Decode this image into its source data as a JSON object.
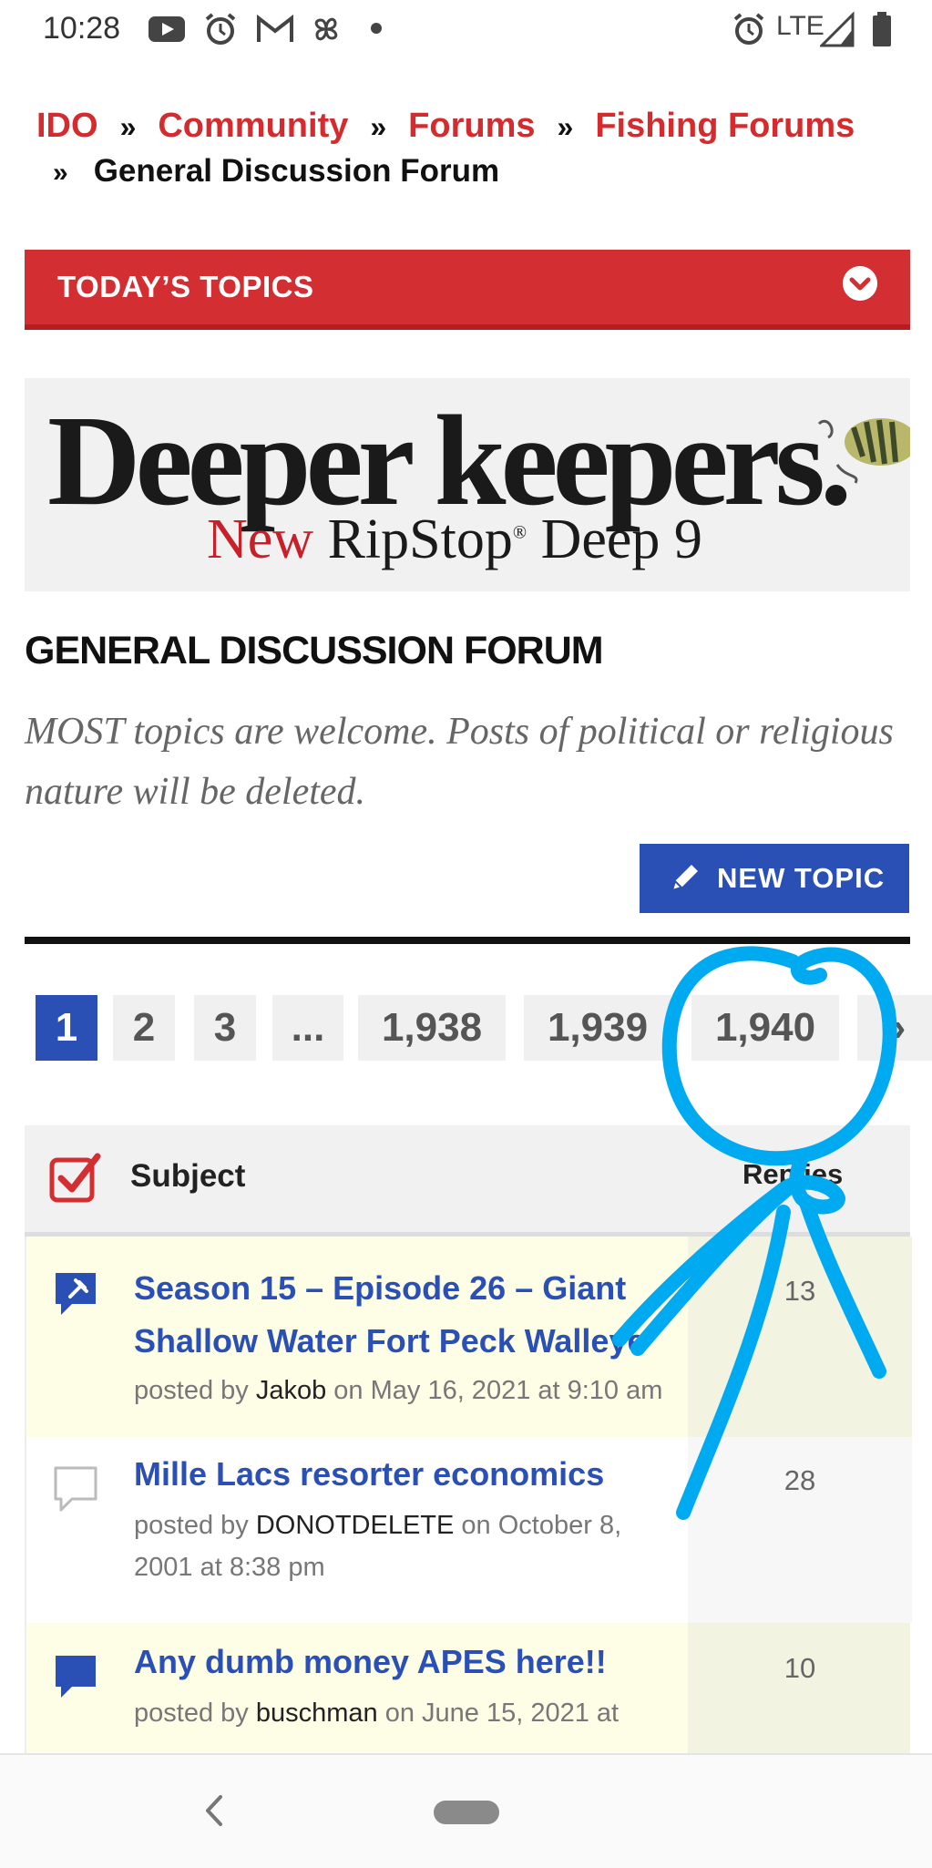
{
  "status_bar": {
    "time": "10:28",
    "network": "LTE",
    "left_icons": [
      "youtube-icon",
      "alarm-icon",
      "gmail-icon",
      "pinwheel-icon"
    ],
    "right_icons": [
      "alarm-icon",
      "signal-icon",
      "battery-icon"
    ]
  },
  "breadcrumb": {
    "items": [
      "IDO",
      "Community",
      "Forums",
      "Fishing Forums"
    ],
    "separator": "»",
    "current": "General Discussion Forum"
  },
  "todays_topics": {
    "label": "TODAY’S TOPICS",
    "color": "#d32f33"
  },
  "banner": {
    "headline": "Deeper keepers.",
    "sub_new": "New",
    "sub_rest": "RipStop",
    "sub_mark": "®",
    "sub_tail": "Deep 9"
  },
  "forum": {
    "title": "GENERAL DISCUSSION FORUM",
    "description": "MOST topics are welcome. Posts of political or religious nature will be deleted.",
    "new_topic_label": "NEW TOPIC",
    "accent": "#2a4fb5"
  },
  "pagination": {
    "pages": [
      "1",
      "2",
      "3",
      "...",
      "1,938",
      "1,939",
      "1,940",
      "»"
    ],
    "current": "1"
  },
  "table": {
    "subject_header": "Subject",
    "replies_header": "Replies",
    "rows": [
      {
        "title": "Season 15 – Episode 26 – Giant Shallow Water Fort Peck Walleye",
        "prefix": "posted by",
        "author": "Jakob",
        "date": "on May 16, 2021 at 9:10 am",
        "replies": "13",
        "icon": "pinned-topic-icon"
      },
      {
        "title": "Mille Lacs resorter economics",
        "prefix": "posted by",
        "author": "DONOTDELETE",
        "date": "on October 8, 2001 at 8:38 pm",
        "replies": "28",
        "icon": "topic-icon"
      },
      {
        "title": "Any dumb money APES here!!",
        "prefix": "posted by",
        "author": "buschman",
        "date": "on June 15, 2021 at",
        "replies": "10",
        "icon": "hot-topic-icon"
      }
    ]
  },
  "annotation": {
    "color": "#00aaf0"
  }
}
